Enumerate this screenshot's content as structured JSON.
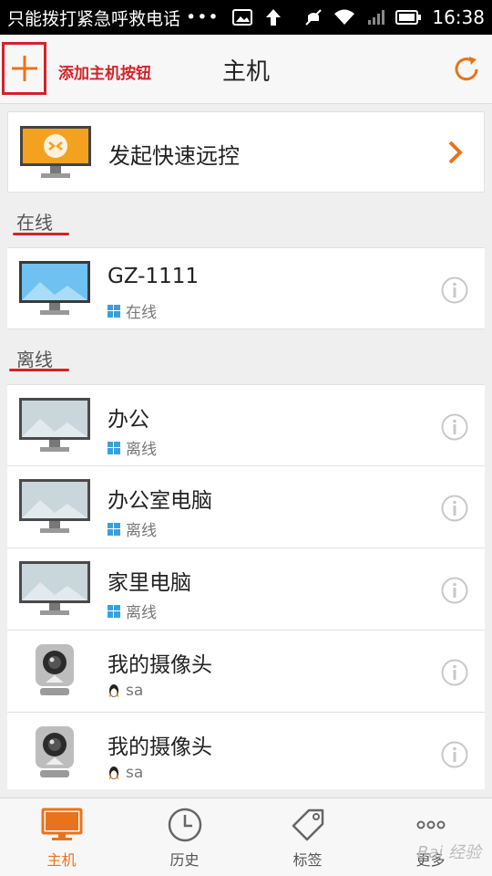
{
  "statusbar": {
    "carrier": "只能拨打紧急呼救电话",
    "dots": "•••",
    "time": "16:38"
  },
  "header": {
    "add_annotation": "添加主机按钮",
    "title": "主机"
  },
  "quick": {
    "label": "发起快速远控"
  },
  "sections": {
    "online": "在线",
    "offline": "离线"
  },
  "online_hosts": [
    {
      "name": "GZ-1111",
      "status": "在线"
    }
  ],
  "offline_hosts": [
    {
      "name": "办公",
      "status": "离线"
    },
    {
      "name": "办公室电脑",
      "status": "离线"
    },
    {
      "name": "家里电脑",
      "status": "离线"
    }
  ],
  "cameras": [
    {
      "name": "我的摄像头",
      "status": "sa"
    },
    {
      "name": "我的摄像头",
      "status": "sa"
    }
  ],
  "tabs": [
    {
      "label": "主机",
      "icon": "monitor-icon",
      "active": true
    },
    {
      "label": "历史",
      "icon": "clock-icon",
      "active": false
    },
    {
      "label": "标签",
      "icon": "tag-icon",
      "active": false
    },
    {
      "label": "更多",
      "icon": "more-dots-icon",
      "active": false
    }
  ],
  "watermark": "Bai 经验",
  "colors": {
    "accent": "#e8731a",
    "annotation_red": "#d2232a",
    "windows_blue": "#3aa0dc"
  }
}
